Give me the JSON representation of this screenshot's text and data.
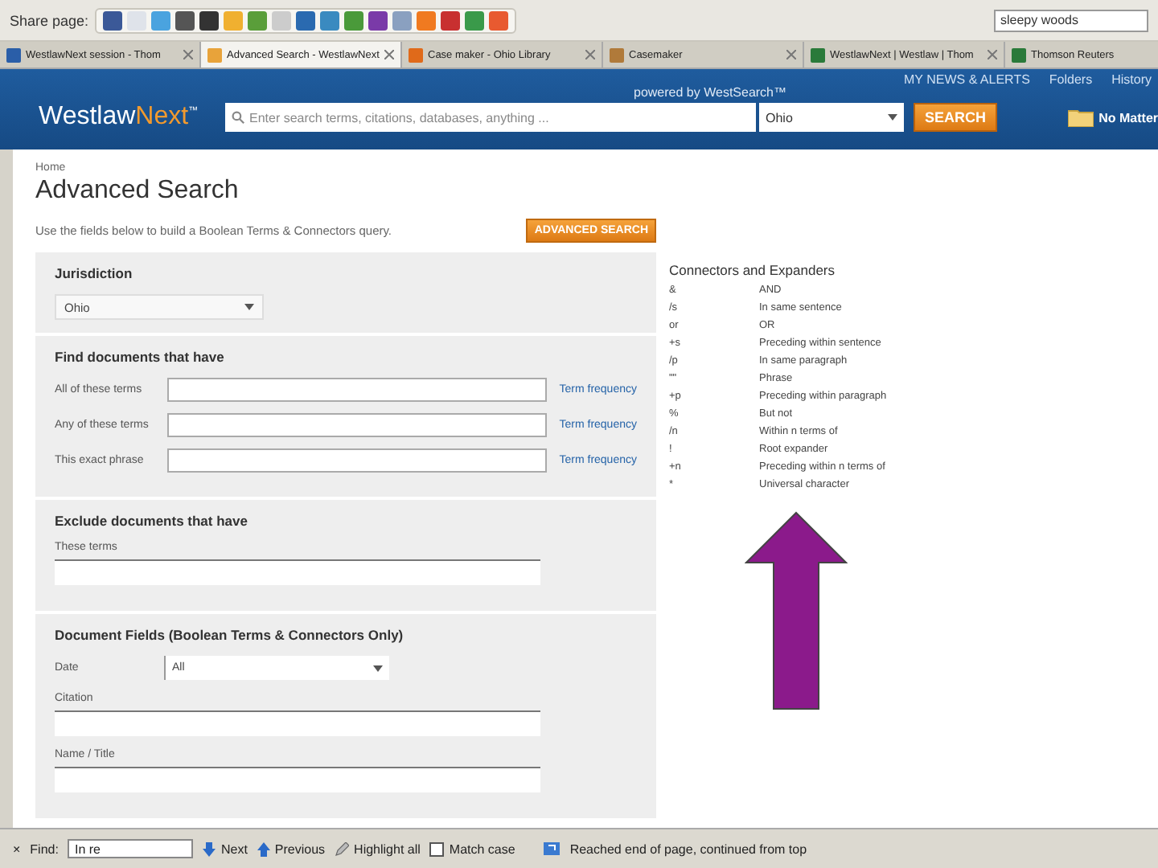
{
  "share_bar": {
    "label": "Share page:",
    "search_value": "sleepy woods"
  },
  "tabs": [
    {
      "label": "WestlawNext session - Thom",
      "selected": false,
      "color": "#2a5ea8"
    },
    {
      "label": "Advanced Search - WestlawNext",
      "selected": true,
      "color": "#e8a33a"
    },
    {
      "label": "Case maker - Ohio Library",
      "selected": false,
      "color": "#e06a1a"
    },
    {
      "label": "Casemaker",
      "selected": false,
      "color": "#b07a3a"
    },
    {
      "label": "WestlawNext | Westlaw | Thom",
      "selected": false,
      "color": "#2a7a3a"
    },
    {
      "label": "Thomson Reuters",
      "selected": false,
      "color": "#2a7a3a"
    }
  ],
  "header": {
    "links": [
      "MY NEWS & ALERTS",
      "Folders",
      "History"
    ],
    "powered": "powered by WestSearch™",
    "logo_main": "Westlaw",
    "logo_accent": "Next",
    "logo_tm": "™",
    "search_placeholder": "Enter search terms, citations, databases, anything ...",
    "jurisdiction": "Ohio",
    "search_button": "SEARCH",
    "folder_label": "No Matter"
  },
  "page": {
    "breadcrumb": "Home",
    "title": "Advanced Search",
    "intro": "Use the fields below to build a Boolean Terms & Connectors query.",
    "button": "ADVANCED SEARCH"
  },
  "sections": [
    {
      "kind": "select",
      "heading": "Jurisdiction",
      "value": "Ohio"
    },
    {
      "kind": "inline",
      "heading": "Find documents that have",
      "rows": [
        {
          "label": "All of these terms",
          "link": "Term frequency"
        },
        {
          "label": "Any of these terms",
          "link": "Term frequency"
        },
        {
          "label": "This exact phrase",
          "link": "Term frequency"
        }
      ]
    },
    {
      "kind": "stacked",
      "heading": "Exclude documents that have",
      "fields": [
        {
          "kind": "text",
          "label": "These terms"
        }
      ]
    },
    {
      "kind": "stacked",
      "heading": "Document Fields (Boolean Terms & Connectors Only)",
      "fields": [
        {
          "kind": "select",
          "label": "Date",
          "value": "All"
        },
        {
          "kind": "text",
          "label": "Citation"
        },
        {
          "kind": "text",
          "label": "Name / Title"
        }
      ]
    }
  ],
  "connectors": {
    "title": "Connectors and Expanders",
    "rows": [
      {
        "symbol": "&",
        "meaning": "AND"
      },
      {
        "symbol": "/s",
        "meaning": "In same sentence"
      },
      {
        "symbol": "or",
        "meaning": "OR"
      },
      {
        "symbol": "+s",
        "meaning": "Preceding within sentence"
      },
      {
        "symbol": "/p",
        "meaning": "In same paragraph"
      },
      {
        "symbol": "\"\"",
        "meaning": "Phrase"
      },
      {
        "symbol": "+p",
        "meaning": "Preceding within paragraph"
      },
      {
        "symbol": "%",
        "meaning": "But not"
      },
      {
        "symbol": "/n",
        "meaning": "Within n terms of"
      },
      {
        "symbol": "!",
        "meaning": "Root expander"
      },
      {
        "symbol": "+n",
        "meaning": "Preceding within n terms of"
      },
      {
        "symbol": "*",
        "meaning": "Universal character"
      }
    ]
  },
  "find_bar": {
    "close": "×",
    "label": "Find:",
    "value": "In re",
    "next": "Next",
    "previous": "Previous",
    "highlight": "Highlight all",
    "match_case": {
      "label": "Match case",
      "checked": false
    },
    "message": "Reached end of page, continued from top"
  }
}
